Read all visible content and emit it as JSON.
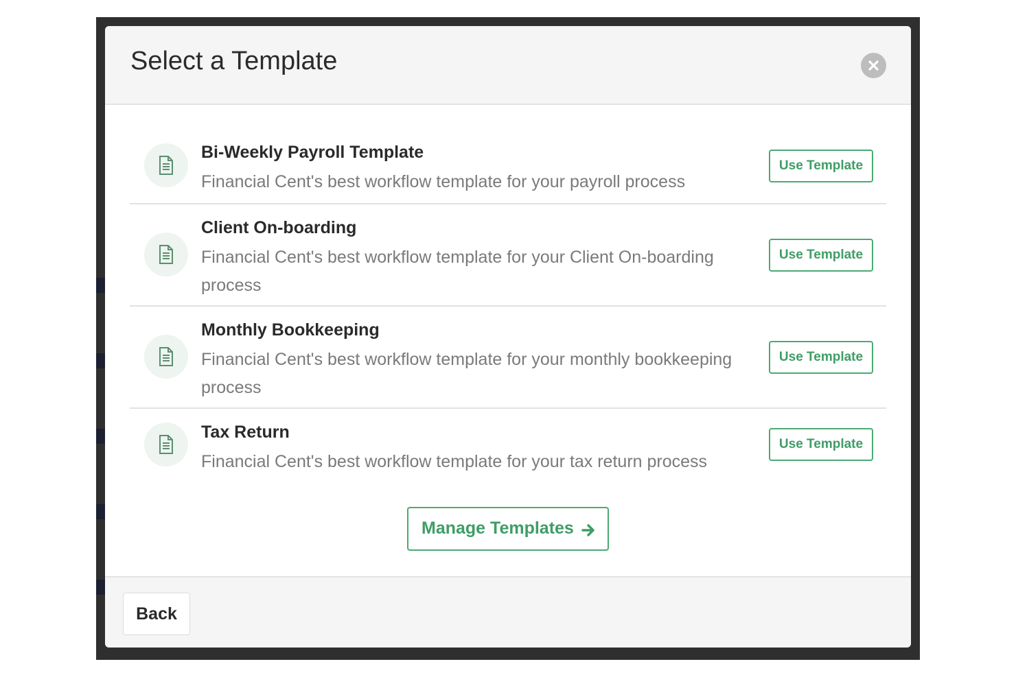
{
  "modal": {
    "title": "Select a Template",
    "close_icon": "close-icon"
  },
  "templates": [
    {
      "name": "Bi-Weekly Payroll Template",
      "description": "Financial Cent's best workflow template for your payroll process",
      "icon": "document-icon",
      "button_label": "Use Template"
    },
    {
      "name": "Client On-boarding",
      "description": "Financial Cent's best workflow template for your Client On-boarding process",
      "icon": "document-icon",
      "button_label": "Use Template"
    },
    {
      "name": "Monthly Bookkeeping",
      "description": "Financial Cent's best workflow template for your monthly bookkeeping process",
      "icon": "document-icon",
      "button_label": "Use Template"
    },
    {
      "name": "Tax Return",
      "description": "Financial Cent's best workflow template for your tax return process",
      "icon": "document-icon",
      "button_label": "Use Template"
    }
  ],
  "manage": {
    "label": "Manage Templates",
    "icon": "arrow-right-icon"
  },
  "footer": {
    "back_label": "Back"
  },
  "colors": {
    "accent": "#3f9d65",
    "header_bg": "#f5f5f5",
    "backdrop": "#2f2f2f"
  }
}
